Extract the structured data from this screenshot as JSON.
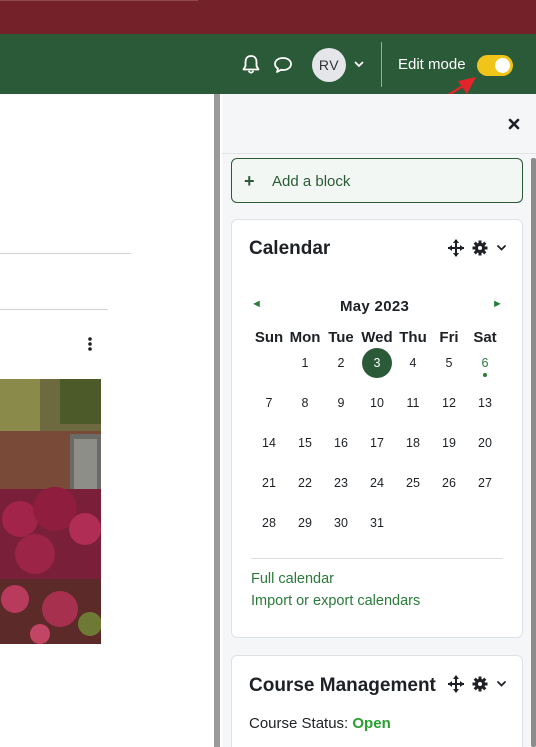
{
  "navbar": {
    "avatar_initials": "RV",
    "edit_mode_label": "Edit mode",
    "edit_mode_on": true,
    "colors": {
      "header": "#74212a",
      "navbar": "#2a5a37",
      "toggle": "#f0c419",
      "accent": "#2a5a37"
    }
  },
  "drawer": {
    "add_block_label": "Add a block"
  },
  "calendar_block": {
    "title": "Calendar",
    "month_label": "May 2023",
    "prev_arrow": "◄",
    "next_arrow": "►",
    "weekdays": [
      "Sun",
      "Mon",
      "Tue",
      "Wed",
      "Thu",
      "Fri",
      "Sat"
    ],
    "weeks": [
      [
        "",
        "1",
        "2",
        "3",
        "4",
        "5",
        "6"
      ],
      [
        "7",
        "8",
        "9",
        "10",
        "11",
        "12",
        "13"
      ],
      [
        "14",
        "15",
        "16",
        "17",
        "18",
        "19",
        "20"
      ],
      [
        "21",
        "22",
        "23",
        "24",
        "25",
        "26",
        "27"
      ],
      [
        "28",
        "29",
        "30",
        "31",
        "",
        "",
        ""
      ]
    ],
    "today": "3",
    "event_day": "6",
    "full_calendar_link": "Full calendar",
    "import_export_link": "Import or export calendars"
  },
  "course_management_block": {
    "title": "Course Management",
    "status_label": "Course Status:",
    "status_value": "Open"
  },
  "icons": [
    "bell-icon",
    "chat-icon",
    "chevron-down-icon",
    "close-icon",
    "move-icon",
    "gear-icon",
    "plus-icon",
    "kebab-menu-icon"
  ]
}
